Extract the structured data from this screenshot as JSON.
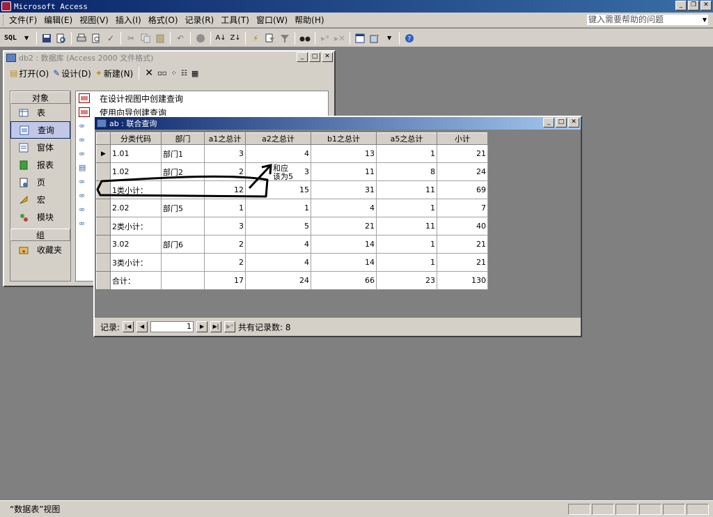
{
  "app": {
    "title": "Microsoft Access"
  },
  "window_buttons": {
    "minimize": "_",
    "restore": "❐",
    "close": "✕"
  },
  "menu": {
    "items": [
      "文件(F)",
      "编辑(E)",
      "视图(V)",
      "插入(I)",
      "格式(O)",
      "记录(R)",
      "工具(T)",
      "窗口(W)",
      "帮助(H)"
    ],
    "help_placeholder": "键入需要帮助的问题"
  },
  "toolbar": {
    "sql_label": "SQL"
  },
  "db_window": {
    "title": "db2 : 数据库 (Access 2000 文件格式)",
    "toolbar": {
      "open": "打开(O)",
      "design": "设计(D)",
      "new": "新建(N)"
    },
    "objects_header": "对象",
    "objects": [
      "表",
      "查询",
      "窗体",
      "报表",
      "页",
      "宏",
      "模块"
    ],
    "selected_object": "查询",
    "groups_header": "组",
    "groups": [
      "收藏夹"
    ],
    "list_items": [
      "在设计视图中创建查询",
      "使用向导创建查询"
    ]
  },
  "query_window": {
    "title": "ab : 联合查询",
    "columns": [
      "分类代码",
      "部门",
      "a1之总计",
      "a2之总计",
      "b1之总计",
      "a5之总计",
      "小计"
    ],
    "rows": [
      [
        "1.01",
        "部门1",
        "3",
        "4",
        "13",
        "1",
        "21"
      ],
      [
        "1.02",
        "部门2",
        "2",
        "3",
        "11",
        "8",
        "24"
      ],
      [
        "1类小计：",
        "",
        "12",
        "15",
        "31",
        "11",
        "69"
      ],
      [
        "2.02",
        "部门5",
        "1",
        "1",
        "4",
        "1",
        "7"
      ],
      [
        "2类小计：",
        "",
        "3",
        "5",
        "21",
        "11",
        "40"
      ],
      [
        "3.02",
        "部门6",
        "2",
        "4",
        "14",
        "1",
        "21"
      ],
      [
        "3类小计：",
        "",
        "2",
        "4",
        "14",
        "1",
        "21"
      ],
      [
        "合计：",
        "",
        "17",
        "24",
        "66",
        "23",
        "130"
      ]
    ],
    "current_row_marker": "▶",
    "annotation": [
      "和应",
      "该为5"
    ],
    "nav": {
      "label": "记录:",
      "current": "1",
      "total_text": "共有记录数: 8"
    }
  },
  "status": {
    "text": "“数据表”视图"
  }
}
